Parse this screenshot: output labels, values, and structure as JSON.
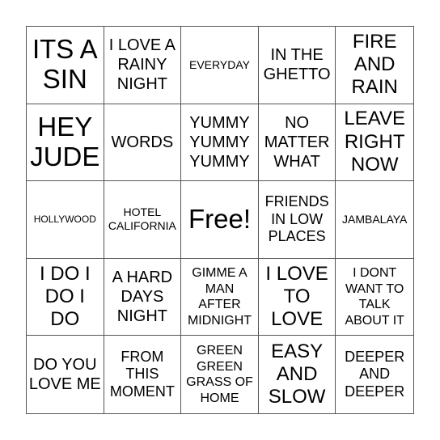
{
  "board": {
    "cells": [
      {
        "text": "ITS A SIN",
        "size": "xl"
      },
      {
        "text": "I LOVE A RAINY NIGHT",
        "size": "m"
      },
      {
        "text": "EVERYDAY",
        "size": "xs"
      },
      {
        "text": "IN THE GHETTO",
        "size": "m"
      },
      {
        "text": "FIRE AND RAIN",
        "size": "l"
      },
      {
        "text": "HEY JUDE",
        "size": "xl"
      },
      {
        "text": "WORDS",
        "size": "m"
      },
      {
        "text": "YUMMY YUMMY YUMMY",
        "size": "m"
      },
      {
        "text": "NO MATTER WHAT",
        "size": "m"
      },
      {
        "text": "LEAVE RIGHT NOW",
        "size": "l"
      },
      {
        "text": "HOLLYWOOD",
        "size": "xxs"
      },
      {
        "text": "HOTEL CALIFORNIA",
        "size": "xs"
      },
      {
        "text": "Free!",
        "size": "xl"
      },
      {
        "text": "FRIENDS IN LOW PLACES",
        "size": "sm"
      },
      {
        "text": "JAMBALAYA",
        "size": "xs"
      },
      {
        "text": "I DO I DO I DO",
        "size": "l"
      },
      {
        "text": "A HARD DAYS NIGHT",
        "size": "m"
      },
      {
        "text": "GIMME A MAN AFTER MIDNIGHT",
        "size": "s"
      },
      {
        "text": "I LOVE TO LOVE",
        "size": "l"
      },
      {
        "text": "I DONT WANT TO TALK ABOUT IT",
        "size": "s"
      },
      {
        "text": "DO YOU LOVE ME",
        "size": "m"
      },
      {
        "text": "FROM THIS MOMENT",
        "size": "sm"
      },
      {
        "text": "GREEN GREEN GRASS OF HOME",
        "size": "s"
      },
      {
        "text": "EASY AND SLOW",
        "size": "l"
      },
      {
        "text": "DEEPER AND DEEPER",
        "size": "sm"
      }
    ]
  }
}
